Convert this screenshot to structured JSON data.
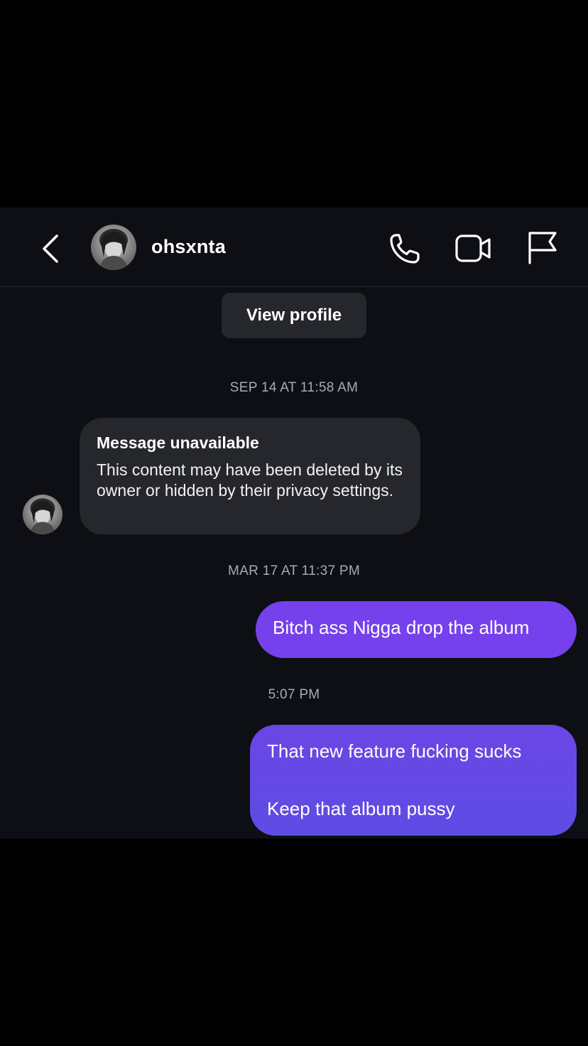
{
  "header": {
    "username": "ohsxnta",
    "icons": [
      "back-chevron-icon",
      "avatar",
      "phone-icon",
      "video-camera-icon",
      "flag-icon"
    ]
  },
  "conversation": {
    "view_profile_label": "View profile",
    "timestamps": [
      "SEP 14 AT 11:58 AM",
      "MAR 17 AT 11:37 PM",
      "5:07 PM"
    ],
    "received": {
      "title": "Message unavailable",
      "body": "This content may have been deleted by its owner or hidden by their privacy settings."
    },
    "sent": [
      {
        "text": "Bitch ass Nigga drop the album"
      },
      {
        "line1": "That new feature fucking sucks",
        "line2": "Keep that album pussy"
      }
    ]
  },
  "colors": {
    "background": "#0e0f14",
    "bubble_received": "#25272d",
    "bubble_sent": "#7040e6",
    "timestamp": "#a8abb3"
  }
}
